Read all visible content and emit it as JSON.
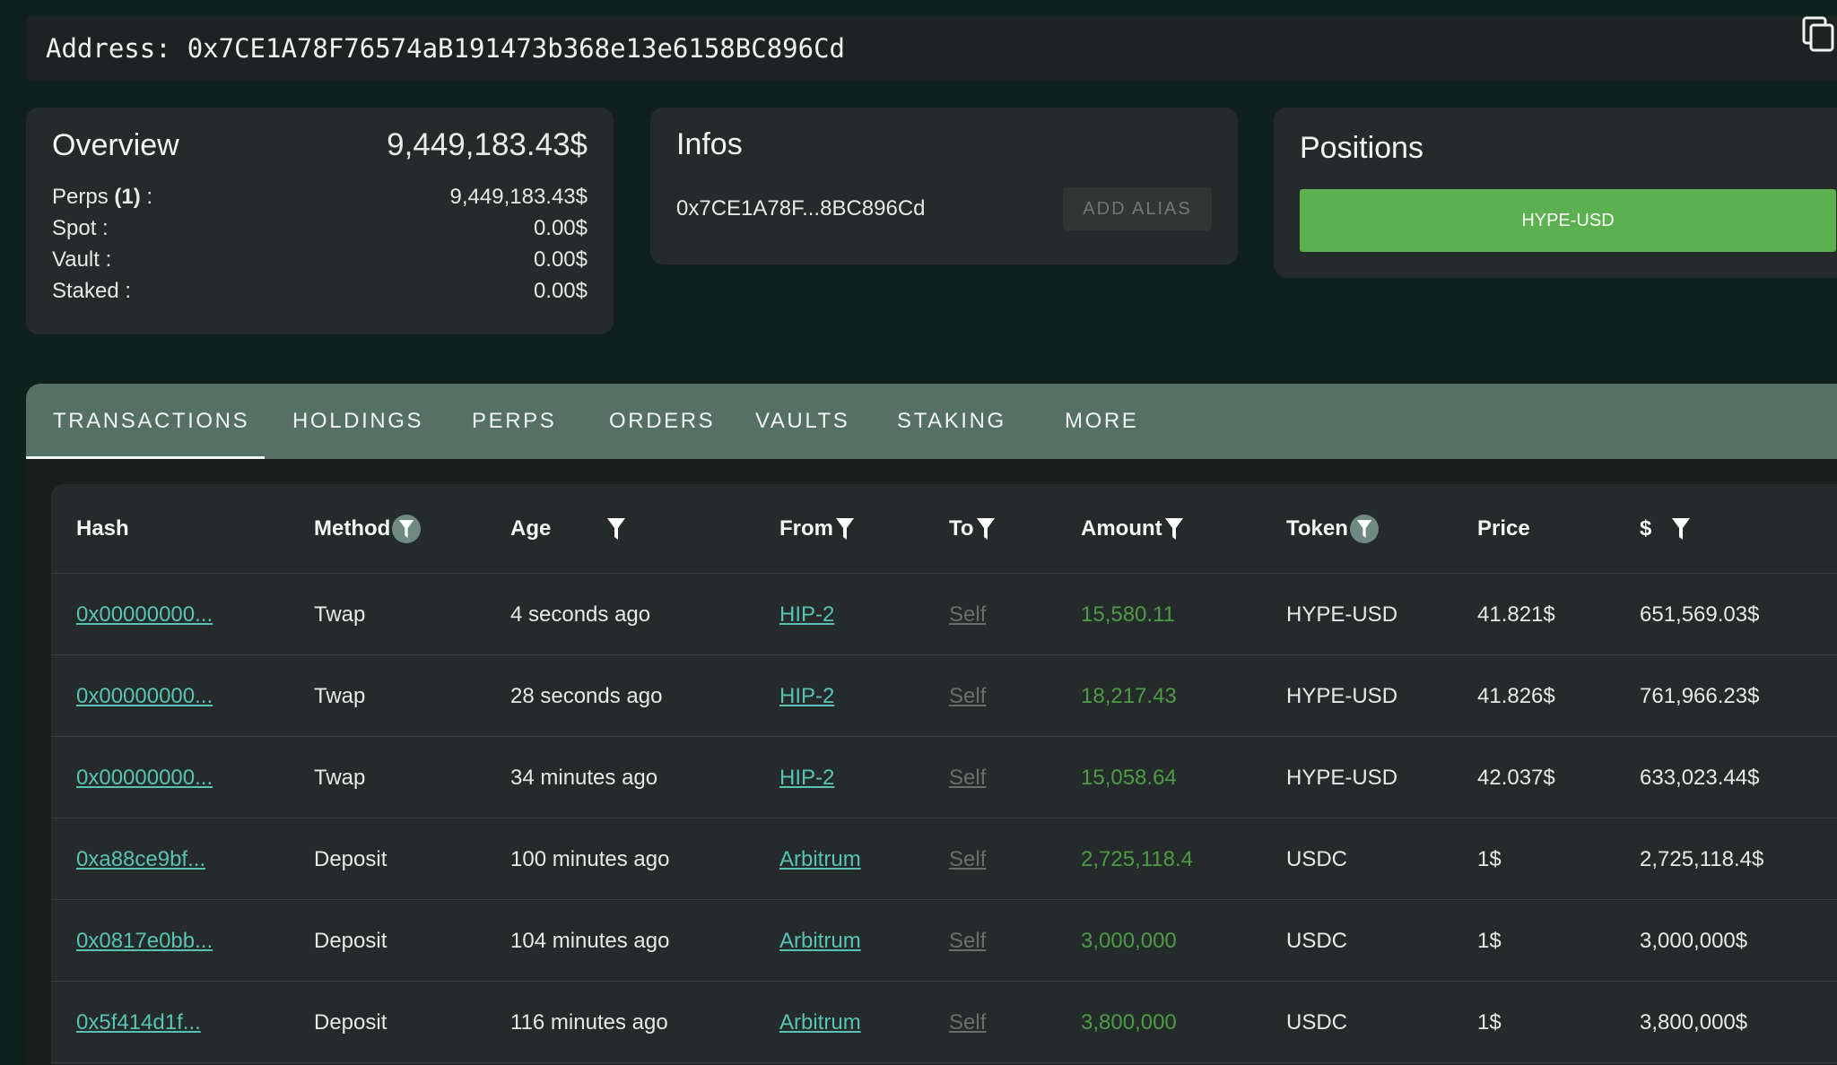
{
  "address": {
    "label": "Address:",
    "value": "0x7CE1A78F76574aB191473b368e13e6158BC896Cd",
    "copy_icon": "copy-icon"
  },
  "overview": {
    "title": "Overview",
    "total": "9,449,183.43$",
    "rows": [
      {
        "label_pre": "Perps ",
        "label_bold": "(1)",
        "label_post": " :",
        "value": "9,449,183.43$"
      },
      {
        "label_pre": "Spot :",
        "label_bold": "",
        "label_post": "",
        "value": "0.00$"
      },
      {
        "label_pre": "Vault :",
        "label_bold": "",
        "label_post": "",
        "value": "0.00$"
      },
      {
        "label_pre": "Staked :",
        "label_bold": "",
        "label_post": "",
        "value": "0.00$"
      }
    ]
  },
  "infos": {
    "title": "Infos",
    "short_address": "0x7CE1A78F...8BC896Cd",
    "alias_button": "ADD ALIAS"
  },
  "positions": {
    "title": "Positions",
    "items": [
      "HYPE-USD"
    ],
    "pill_color": "#5bb050"
  },
  "tabs": [
    {
      "label": "TRANSACTIONS",
      "active": true
    },
    {
      "label": "HOLDINGS",
      "active": false
    },
    {
      "label": "PERPS",
      "active": false
    },
    {
      "label": "ORDERS",
      "active": false
    },
    {
      "label": "VAULTS",
      "active": false
    },
    {
      "label": "STAKING",
      "active": false
    },
    {
      "label": "MORE",
      "active": false
    }
  ],
  "table": {
    "headers": [
      {
        "label": "Hash",
        "filter": "none"
      },
      {
        "label": "Method",
        "filter": "circle"
      },
      {
        "label": "Age",
        "filter": "plain"
      },
      {
        "label": "From",
        "filter": "plain"
      },
      {
        "label": "To",
        "filter": "plain"
      },
      {
        "label": "Amount",
        "filter": "plain"
      },
      {
        "label": "Token",
        "filter": "circle"
      },
      {
        "label": "Price",
        "filter": "none"
      },
      {
        "label": "$",
        "filter": "plain"
      }
    ],
    "rows": [
      {
        "hash": "0x00000000...",
        "method": "Twap",
        "age": "4 seconds ago",
        "from": "HIP-2",
        "to": "Self",
        "amount": "15,580.11",
        "token": "HYPE-USD",
        "price": "41.821$",
        "usd": "651,569.03$"
      },
      {
        "hash": "0x00000000...",
        "method": "Twap",
        "age": "28 seconds ago",
        "from": "HIP-2",
        "to": "Self",
        "amount": "18,217.43",
        "token": "HYPE-USD",
        "price": "41.826$",
        "usd": "761,966.23$"
      },
      {
        "hash": "0x00000000...",
        "method": "Twap",
        "age": "34 minutes ago",
        "from": "HIP-2",
        "to": "Self",
        "amount": "15,058.64",
        "token": "HYPE-USD",
        "price": "42.037$",
        "usd": "633,023.44$"
      },
      {
        "hash": "0xa88ce9bf...",
        "method": "Deposit",
        "age": "100 minutes ago",
        "from": "Arbitrum",
        "to": "Self",
        "amount": "2,725,118.4",
        "token": "USDC",
        "price": "1$",
        "usd": "2,725,118.4$"
      },
      {
        "hash": "0x0817e0bb...",
        "method": "Deposit",
        "age": "104 minutes ago",
        "from": "Arbitrum",
        "to": "Self",
        "amount": "3,000,000",
        "token": "USDC",
        "price": "1$",
        "usd": "3,000,000$"
      },
      {
        "hash": "0x5f414d1f...",
        "method": "Deposit",
        "age": "116 minutes ago",
        "from": "Arbitrum",
        "to": "Self",
        "amount": "3,800,000",
        "token": "USDC",
        "price": "1$",
        "usd": "3,800,000$"
      }
    ]
  },
  "colors": {
    "background": "#10211d",
    "tabbar": "#557065",
    "link": "#58c3b5",
    "amount": "#4e9b46"
  }
}
